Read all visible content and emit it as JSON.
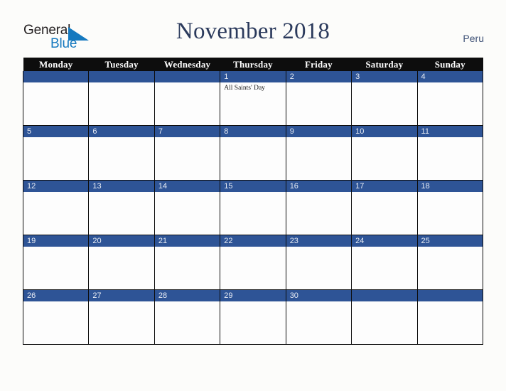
{
  "brand": {
    "name_part1": "General",
    "name_part2": "Blue",
    "triangle_icon": "blue-triangle-logo-icon",
    "color_dark": "#231f20",
    "color_blue": "#1579bf"
  },
  "header": {
    "title": "November 2018",
    "country": "Peru",
    "title_color": "#2b3a5c",
    "country_color": "#3f5277"
  },
  "theme": {
    "background": "#fcfcfa",
    "header_row_bg": "#0d0d0d",
    "header_row_text": "#ffffff",
    "date_bar_bg": "#2e5496",
    "date_bar_text": "#e8ecf4",
    "cell_bg": "#fdfdfd",
    "grid_line": "#0d0d0d"
  },
  "weekday_headers": [
    "Monday",
    "Tuesday",
    "Wednesday",
    "Thursday",
    "Friday",
    "Saturday",
    "Sunday"
  ],
  "weeks": [
    [
      {
        "day": "",
        "events": []
      },
      {
        "day": "",
        "events": []
      },
      {
        "day": "",
        "events": []
      },
      {
        "day": "1",
        "events": [
          "All Saints' Day"
        ]
      },
      {
        "day": "2",
        "events": []
      },
      {
        "day": "3",
        "events": []
      },
      {
        "day": "4",
        "events": []
      }
    ],
    [
      {
        "day": "5",
        "events": []
      },
      {
        "day": "6",
        "events": []
      },
      {
        "day": "7",
        "events": []
      },
      {
        "day": "8",
        "events": []
      },
      {
        "day": "9",
        "events": []
      },
      {
        "day": "10",
        "events": []
      },
      {
        "day": "11",
        "events": []
      }
    ],
    [
      {
        "day": "12",
        "events": []
      },
      {
        "day": "13",
        "events": []
      },
      {
        "day": "14",
        "events": []
      },
      {
        "day": "15",
        "events": []
      },
      {
        "day": "16",
        "events": []
      },
      {
        "day": "17",
        "events": []
      },
      {
        "day": "18",
        "events": []
      }
    ],
    [
      {
        "day": "19",
        "events": []
      },
      {
        "day": "20",
        "events": []
      },
      {
        "day": "21",
        "events": []
      },
      {
        "day": "22",
        "events": []
      },
      {
        "day": "23",
        "events": []
      },
      {
        "day": "24",
        "events": []
      },
      {
        "day": "25",
        "events": []
      }
    ],
    [
      {
        "day": "26",
        "events": []
      },
      {
        "day": "27",
        "events": []
      },
      {
        "day": "28",
        "events": []
      },
      {
        "day": "29",
        "events": []
      },
      {
        "day": "30",
        "events": []
      },
      {
        "day": "",
        "events": []
      },
      {
        "day": "",
        "events": []
      }
    ]
  ]
}
